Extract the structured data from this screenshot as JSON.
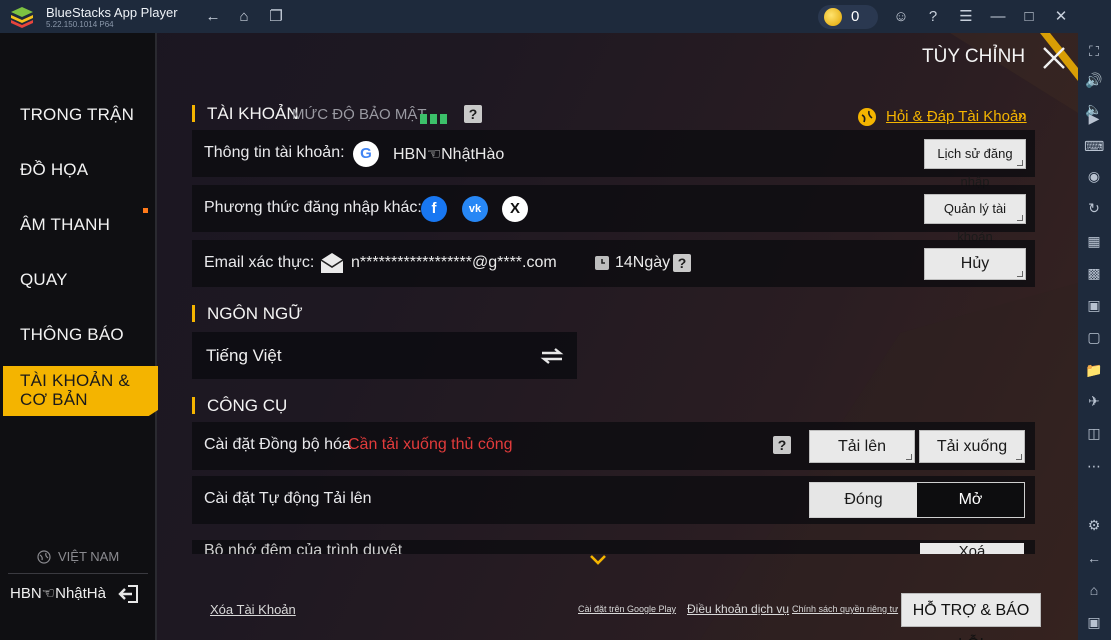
{
  "window": {
    "app_title": "BlueStacks App Player",
    "version": "5.22.150.1014  P64",
    "coin_count": "0"
  },
  "game": {
    "header_title": "TÙY CHỈNH",
    "nav": [
      {
        "label": "TRONG TRẬN"
      },
      {
        "label": "ĐỒ HỌA"
      },
      {
        "label": "ÂM THANH"
      },
      {
        "label": "QUAY"
      },
      {
        "label": "THÔNG BÁO"
      },
      {
        "label": "TÀI KHOẢN & CƠ BẢN"
      }
    ],
    "region": "VIỆT NAM",
    "player_name": "HBN☜NhậtHà",
    "account": {
      "section_title": "TÀI KHOẢN",
      "security_label": "MỨC ĐỘ BẢO MẬT",
      "help_link": "Hỏi & Đáp Tài Khoản",
      "info_label": "Thông tin tài khoản:",
      "info_value": "HBN☜NhậtHào",
      "login_history_button": "Lịch sử đăng nhập",
      "other_login_label": "Phương thức đăng nhập khác:",
      "manage_account_button": "Quản lý tài khoản",
      "email_label": "Email xác thực:",
      "email_value": "n******************@g****.com",
      "email_days": "14Ngày",
      "cancel_button": "Hủy"
    },
    "language": {
      "section_title": "NGÔN NGỮ",
      "value": "Tiếng Việt"
    },
    "tools": {
      "section_title": "CÔNG CỤ",
      "sync_label": "Cài đặt Đồng bộ hóa",
      "sync_warning": "Cần tải xuống thủ công",
      "upload_button": "Tải lên",
      "download_button": "Tải xuống",
      "auto_upload_label": "Cài đặt Tự động Tải lên",
      "toggle_off": "Đóng",
      "toggle_on": "Mở",
      "partial_row_label": "Bộ nhớ đệm của trình duyệt",
      "partial_button": "Xoá"
    },
    "footer": {
      "delete_account": "Xóa Tài Khoản",
      "google_play_settings": "Cài đặt trên Google Play",
      "terms": "Điều khoản dịch vụ",
      "privacy": "Chính sách quyền riêng tư",
      "support_button": "HỖ TRỢ & BÁO LỖI"
    }
  }
}
